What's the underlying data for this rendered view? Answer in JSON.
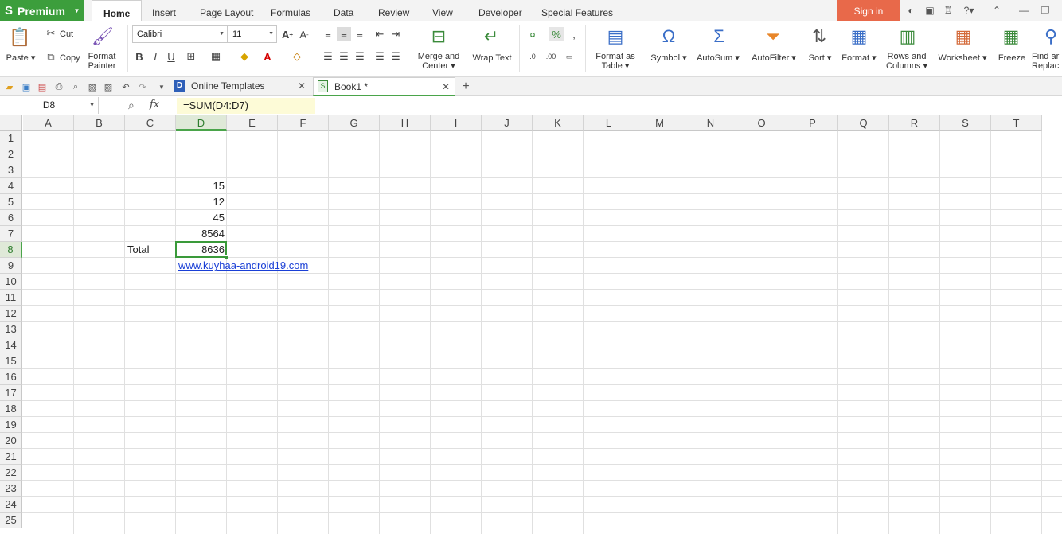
{
  "brand": {
    "label": "Premium",
    "logo_glyph": "S"
  },
  "menu": {
    "tabs": [
      "Home",
      "Insert",
      "Page Layout",
      "Formulas",
      "Data",
      "Review",
      "View",
      "Developer",
      "Special Features"
    ],
    "sign_in": "Sign in"
  },
  "ribbon": {
    "paste": "Paste",
    "cut": "Cut",
    "copy": "Copy",
    "format_painter_1": "Format",
    "format_painter_2": "Painter",
    "font_name": "Calibri",
    "font_size": "11",
    "bold": "B",
    "italic": "I",
    "underline": "U",
    "merge_center_1": "Merge and",
    "merge_center_2": "Center",
    "wrap_text": "Wrap Text",
    "format_as_table_1": "Format as",
    "format_as_table_2": "Table",
    "symbol": "Symbol",
    "autosum": "AutoSum",
    "autofilter": "AutoFilter",
    "sort": "Sort",
    "format": "Format",
    "rows_columns_1": "Rows and",
    "rows_columns_2": "Columns",
    "worksheet": "Worksheet",
    "freeze": "Freeze",
    "find_replace_1": "Find ar",
    "find_replace_2": "Replac"
  },
  "tabs": {
    "online_templates": "Online Templates",
    "book1": "Book1 *"
  },
  "formula_bar": {
    "name_box": "D8",
    "fx": "fx",
    "formula": "=SUM(D4:D7)"
  },
  "grid": {
    "columns": [
      "A",
      "B",
      "C",
      "D",
      "E",
      "F",
      "G",
      "H",
      "I",
      "J",
      "K",
      "L",
      "M",
      "N",
      "O",
      "P",
      "Q",
      "R",
      "S",
      "T"
    ],
    "rows": [
      "1",
      "2",
      "3",
      "4",
      "5",
      "6",
      "7",
      "8",
      "9",
      "10",
      "11",
      "12",
      "13",
      "14",
      "15",
      "16",
      "17",
      "18",
      "19",
      "20",
      "21",
      "22",
      "23",
      "24",
      "25"
    ],
    "selected_column": "D",
    "selected_row": "8",
    "cells": {
      "D4": "15",
      "D5": "12",
      "D6": "45",
      "D7": "8564",
      "C8": "Total",
      "D8": "8636",
      "D9": "www.kuyhaa-android19.com"
    }
  },
  "colors": {
    "brand_green": "#3c9e3c",
    "sign_in_bg": "#e8694a",
    "selection": "#3a9a3a",
    "link": "#1a3fd6",
    "formula_bg": "#fdfbd7"
  }
}
